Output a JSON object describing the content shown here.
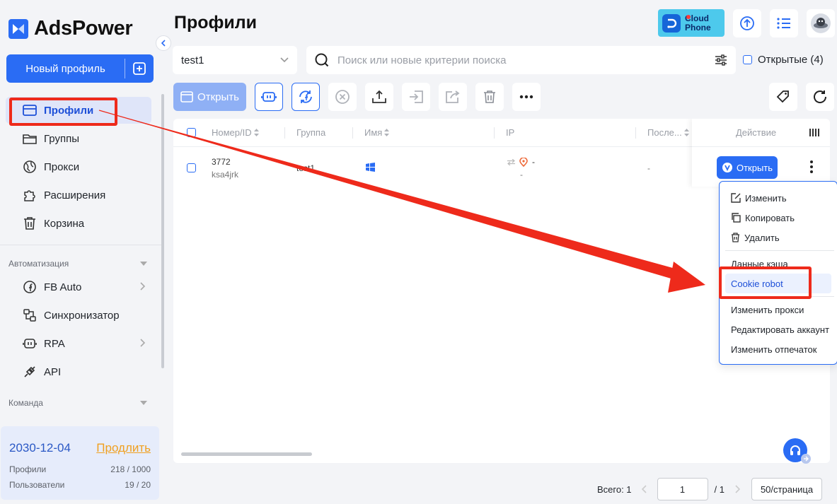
{
  "app": {
    "name": "AdsPower"
  },
  "sidebar": {
    "new_profile_label": "Новый профиль",
    "nav": [
      {
        "label": "Профили",
        "icon": "window-icon",
        "active": true
      },
      {
        "label": "Группы",
        "icon": "folder-icon"
      },
      {
        "label": "Прокси",
        "icon": "globe-icon"
      },
      {
        "label": "Расширения",
        "icon": "puzzle-icon"
      },
      {
        "label": "Корзина",
        "icon": "trash-icon"
      }
    ],
    "automation_label": "Автоматизация",
    "automation": [
      {
        "label": "FB Auto",
        "icon": "fb-icon",
        "has_submenu": true
      },
      {
        "label": "Синхронизатор",
        "icon": "sync-icon"
      },
      {
        "label": "RPA",
        "icon": "robot-icon",
        "has_submenu": true
      },
      {
        "label": "API",
        "icon": "plug-icon"
      }
    ],
    "team_label": "Команда",
    "plan": {
      "expiry": "2030-12-04",
      "renew": "Продлить",
      "profiles_label": "Профили",
      "profiles_value": "218 / 1000",
      "users_label": "Пользователи",
      "users_value": "19 / 20"
    }
  },
  "header": {
    "title": "Профили",
    "cloud_phone_line1": "Cloud",
    "cloud_phone_line2": "Phone"
  },
  "filters": {
    "group": "test1",
    "search_placeholder": "Поиск или новые критерии поиска",
    "opened_label": "Открытые (4)"
  },
  "toolbar": {
    "open_label": "Открыть"
  },
  "table": {
    "columns": {
      "number": "Номер/ID",
      "group": "Группа",
      "name": "Имя",
      "ip": "IP",
      "last": "После...",
      "action": "Действие"
    },
    "rows": [
      {
        "number": "3772",
        "id": "ksa4jrk",
        "group": "test1",
        "ip": "-",
        "ip_sub": "-",
        "last": "-",
        "open_label": "Открыть"
      }
    ]
  },
  "menu": {
    "items": [
      {
        "label": "Изменить",
        "icon": "edit-icon"
      },
      {
        "label": "Копировать",
        "icon": "copy-icon"
      },
      {
        "label": "Удалить",
        "icon": "delete-icon"
      },
      {
        "label": "Данные кэша"
      },
      {
        "label": "Cookie robot",
        "highlighted": true
      },
      {
        "label": "Изменить прокси"
      },
      {
        "label": "Редактировать аккаунт"
      },
      {
        "label": "Изменить отпечаток"
      }
    ]
  },
  "pagination": {
    "total": "Всего: 1",
    "page": "1",
    "of": "/ 1",
    "page_size": "50/страница"
  },
  "colors": {
    "primary": "#2a6cf4",
    "annotation_red": "#ee2a1b",
    "renew_orange": "#f0a020"
  }
}
